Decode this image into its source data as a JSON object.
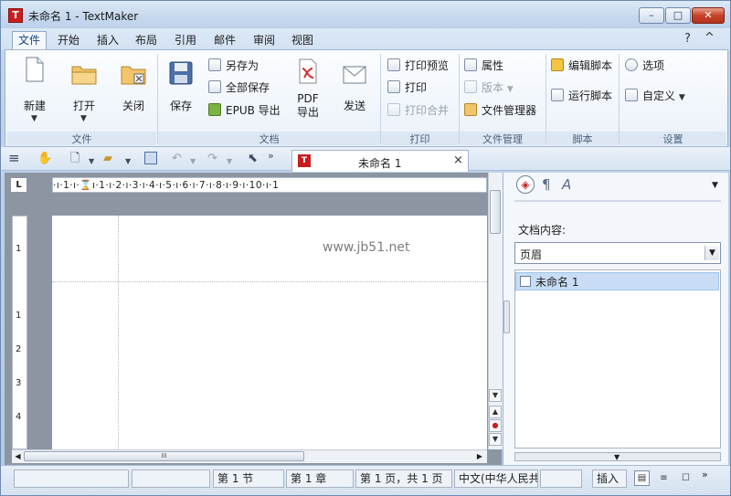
{
  "window": {
    "title": "未命名 1 - TextMaker",
    "app_icon_letter": "T",
    "minimize": "–",
    "maximize": "□",
    "close": "✕"
  },
  "menu": {
    "items": [
      "文件",
      "开始",
      "插入",
      "布局",
      "引用",
      "邮件",
      "审阅",
      "视图"
    ],
    "active": "文件",
    "help": "?",
    "collapse": "^"
  },
  "ribbon": {
    "groups": {
      "file": {
        "label": "文件",
        "new": "新建",
        "open": "打开",
        "close": "关闭"
      },
      "document": {
        "label": "文档",
        "save": "保存",
        "save_as": "另存为",
        "save_all": "全部保存",
        "epub_export": "EPUB 导出",
        "pdf_export": "PDF\n导出",
        "pdf_line1": "PDF",
        "pdf_line2": "导出",
        "send": "发送"
      },
      "print": {
        "label": "打印",
        "print_preview": "打印预览",
        "print": "打印",
        "print_merge": "打印合并"
      },
      "file_management": {
        "label": "文件管理",
        "properties": "属性",
        "versions": "版本",
        "file_manager": "文件管理器"
      },
      "script": {
        "label": "脚本",
        "edit_script": "编辑脚本",
        "run_script": "运行脚本"
      },
      "settings": {
        "label": "设置",
        "options": "选项",
        "customize": "自定义"
      }
    }
  },
  "toolbar": {
    "more": "»"
  },
  "document_tab": {
    "title": "未命名 1",
    "close": "×"
  },
  "ruler": {
    "corner": "L",
    "horizontal_text": "·ı·1·ı·⌛ı·1·ı·2·ı·3·ı·4·ı·5·ı·6·ı·7·ı·8·ı·9·ı·10·ı·1",
    "vertical_numbers": [
      "1",
      "1",
      "2",
      "3",
      "4"
    ]
  },
  "page": {
    "watermark": "www.jb51.net"
  },
  "side_panel": {
    "heading": "文档内容:",
    "select_value": "页眉",
    "items": [
      "未命名 1"
    ]
  },
  "statusbar": {
    "section": "第 1 节",
    "chapter": "第 1 章",
    "page": "第 1 页，共 1 页",
    "language": "中文(中华人民共",
    "mode": "插入"
  }
}
